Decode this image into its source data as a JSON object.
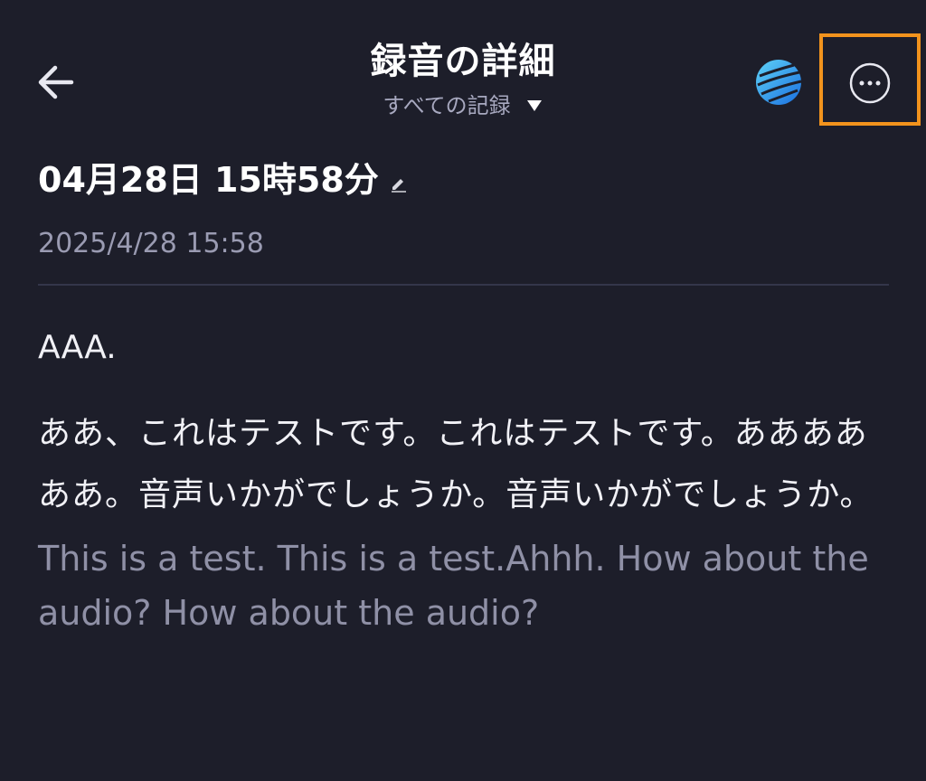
{
  "header": {
    "title": "録音の詳細",
    "filter_label": "すべての記録",
    "back_icon": "arrow-left-icon",
    "globe_icon": "globe-icon",
    "more_icon": "more-horizontal-icon",
    "highlight_color": "#f2931d"
  },
  "recording": {
    "title": "04月28日 15時58分",
    "timestamp": "2025/4/28 15:58"
  },
  "transcript": {
    "line1": "AAA.",
    "line2": "ああ、これはテストです。これはテストです。ああああああ。音声いかがでしょうか。音声いかがでしょうか。",
    "translation": "This is a test. This is a test.Ahhh. How about the audio? How about the audio?"
  },
  "colors": {
    "background": "#1d1e2a",
    "primary_text": "#f4f4f8",
    "secondary_text": "#9a9bb2"
  }
}
